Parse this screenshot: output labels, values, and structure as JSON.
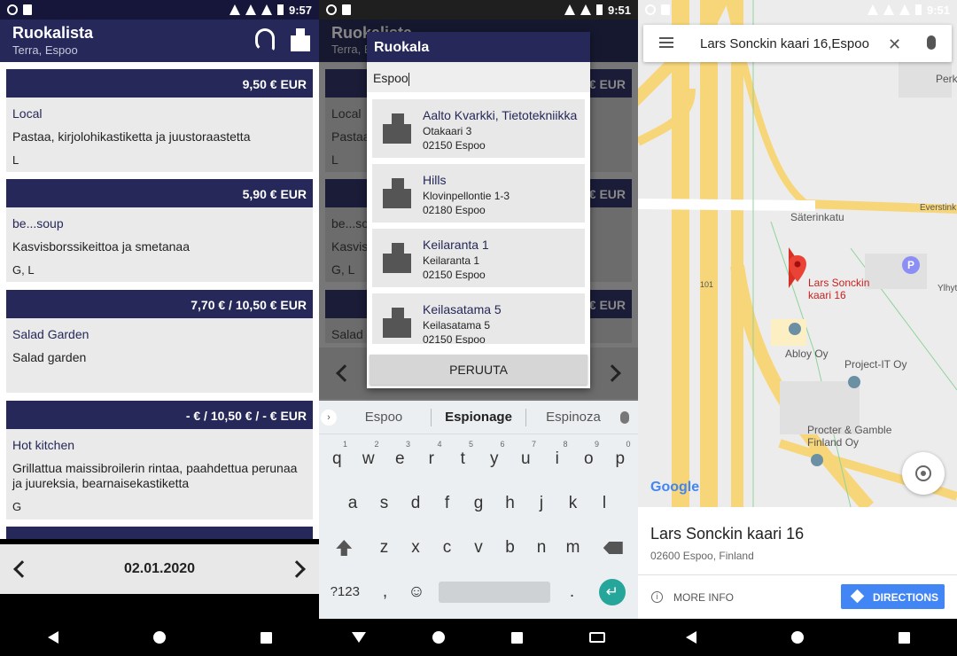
{
  "status": {
    "time1": "9:57",
    "time2": "9:51",
    "time3": "9:51"
  },
  "panel1": {
    "app_title": "Ruokalista",
    "app_subtitle": "Terra, Espoo",
    "menu": [
      {
        "price": "9,50 € EUR",
        "category": "Local",
        "description": "Pastaa, kirjolohikastiketta ja juustoraastetta",
        "diet": "L"
      },
      {
        "price": "5,90 € EUR",
        "category": "be...soup",
        "description": "Kasvisborssikeittoa ja smetanaa",
        "diet": "G, L"
      },
      {
        "price": "7,70 € / 10,50 € EUR",
        "category": "Salad Garden",
        "description": "Salad garden",
        "diet": ""
      },
      {
        "price": "- € / 10,50 € / - € EUR",
        "category": "Hot kitchen",
        "description": "Grillattua  maissibroilerin rintaa, paahdettua perunaa ja juureksia, bearnaisekastiketta",
        "diet": "G"
      }
    ],
    "date": "02.01.2020"
  },
  "panel2": {
    "bg_title": "Ruokalista",
    "bg_subtitle": "Terra, Espoo",
    "bg_prices": [
      "€ EUR",
      "€ EUR",
      "€ EUR"
    ],
    "bg_cat1": "Local",
    "bg_desc1": "Pastaa",
    "bg_diet1": "L",
    "bg_cat2": "be...so",
    "bg_desc2": "Kasvis",
    "bg_diet2": "G, L",
    "bg_cat3": "Salad",
    "dialog_title": "Ruokala",
    "search_value": "Espoo",
    "results": [
      {
        "name": "Aalto Kvarkki, Tietotekniikka",
        "street": "Otakaari 3",
        "city": "02150 Espoo"
      },
      {
        "name": "Hills",
        "street": "Klovinpellontie 1-3",
        "city": "02180 Espoo"
      },
      {
        "name": "Keilaranta 1",
        "street": "Keilaranta 1",
        "city": "02150 Espoo"
      },
      {
        "name": "Keilasatama 5",
        "street": "Keilasatama 5",
        "city": "02150 Espoo"
      }
    ],
    "cancel_label": "PERUUTA",
    "suggestions": [
      "Espoo",
      "Espionage",
      "Espinoza"
    ],
    "row1": [
      "q",
      "w",
      "e",
      "r",
      "t",
      "y",
      "u",
      "i",
      "o",
      "p"
    ],
    "row1_nums": [
      "1",
      "2",
      "3",
      "4",
      "5",
      "6",
      "7",
      "8",
      "9",
      "0"
    ],
    "row2": [
      "a",
      "s",
      "d",
      "f",
      "g",
      "h",
      "j",
      "k",
      "l"
    ],
    "row3": [
      "z",
      "x",
      "c",
      "v",
      "b",
      "n",
      "m"
    ],
    "key_123": "?123",
    "key_comma": ",",
    "key_period": ".",
    "emoji": "☺",
    "enter": "↵"
  },
  "panel3": {
    "search_query": "Lars Sonckin kaari 16,Espoo",
    "pin_label_1": "Lars Sonckin",
    "pin_label_2": "kaari 16",
    "street_1": "Säterinkatu",
    "street_2": "Everstink",
    "street_3": "Ylhyt",
    "street_4": "Perk",
    "road_num": "101",
    "poi_1": "Abloy Oy",
    "poi_2": "Project-IT Oy",
    "poi_3_line1": "Procter & Gamble",
    "poi_3_line2": "Finland Oy",
    "poi_p": "P",
    "google": "Google",
    "place_name": "Lars Sonckin kaari 16",
    "place_address": "02600 Espoo, Finland",
    "more_info": "MORE INFO",
    "directions": "DIRECTIONS"
  }
}
